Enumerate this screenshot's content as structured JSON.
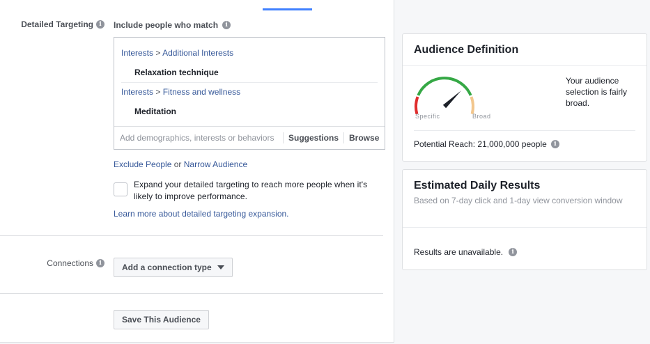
{
  "detailed_targeting": {
    "label": "Detailed Targeting",
    "include_label": "Include people who match",
    "groups": [
      {
        "category": "Interests",
        "separator": ">",
        "subcategory": "Additional Interests",
        "item": "Relaxation technique"
      },
      {
        "category": "Interests",
        "separator": ">",
        "subcategory": "Fitness and wellness",
        "item": "Meditation"
      }
    ],
    "search_placeholder": "Add demographics, interests or behaviors",
    "suggestions_label": "Suggestions",
    "browse_label": "Browse",
    "exclude_people_label": "Exclude People",
    "or_text": "or",
    "narrow_audience_label": "Narrow Audience",
    "expand_text": "Expand your detailed targeting to reach more people when it's likely to improve performance.",
    "learn_more_label": "Learn more about detailed targeting expansion."
  },
  "connections": {
    "label": "Connections",
    "button_label": "Add a connection type"
  },
  "save_audience_label": "Save This Audience",
  "audience_definition": {
    "title": "Audience Definition",
    "gauge_left_label": "Specific",
    "gauge_right_label": "Broad",
    "gauge_level": 0.72,
    "description": "Your audience selection is fairly broad.",
    "potential_reach": "Potential Reach: 21,000,000 people"
  },
  "estimated_daily_results": {
    "title": "Estimated Daily Results",
    "subtitle": "Based on 7-day click and 1-day view conversion window",
    "results_text": "Results are unavailable."
  },
  "colors": {
    "link": "#365899",
    "tab_indicator": "#4080ff",
    "gauge_red": "#e02e2e",
    "gauge_green": "#35a845",
    "gauge_orange": "#f2c68d",
    "needle": "#1d2129"
  },
  "icons": {
    "info": "info-icon",
    "dropdown": "caret-down-icon",
    "gauge": "gauge-icon"
  }
}
